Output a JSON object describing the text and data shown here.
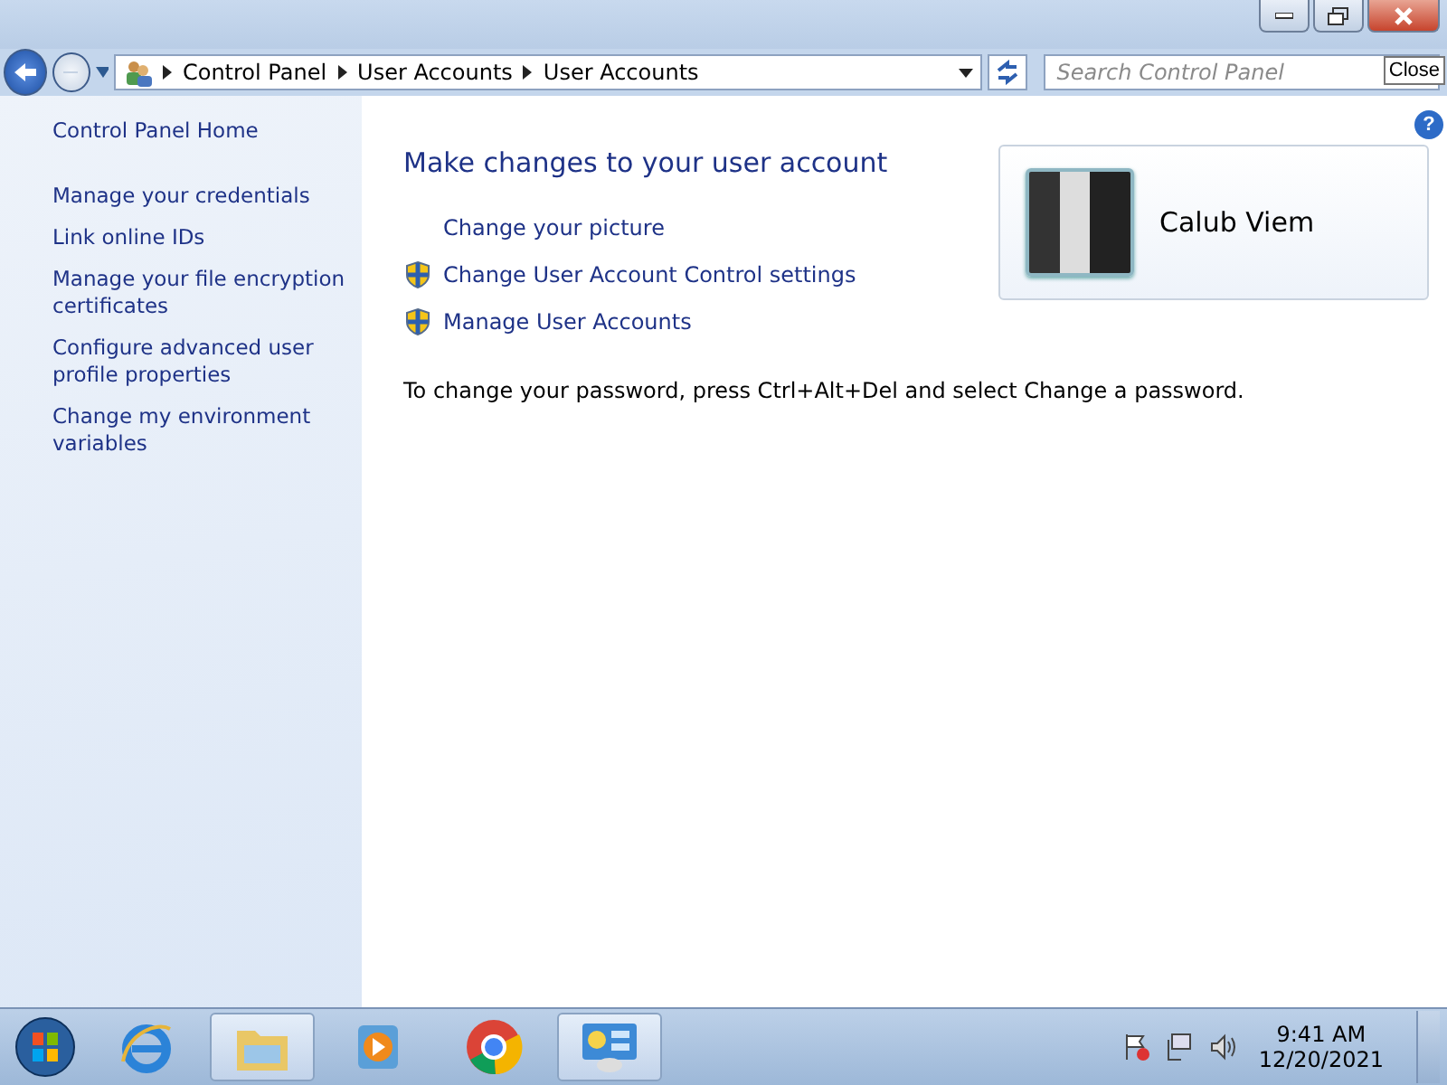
{
  "window": {
    "tooltip": "Close"
  },
  "address_bar": {
    "breadcrumbs": [
      "Control Panel",
      "User Accounts",
      "User Accounts"
    ]
  },
  "search": {
    "placeholder": "Search Control Panel"
  },
  "help_button": "?",
  "sidebar": {
    "items": [
      {
        "label": "Control Panel Home"
      },
      {
        "label": "Manage your credentials"
      },
      {
        "label": "Link online IDs"
      },
      {
        "label": "Manage your file encryption certificates"
      },
      {
        "label": "Configure advanced user profile properties"
      },
      {
        "label": "Change my environment variables"
      }
    ]
  },
  "main": {
    "heading": "Make changes to your user account",
    "tasks": [
      {
        "label": "Change your picture",
        "shield": false
      },
      {
        "label": "Change User Account Control settings",
        "shield": true
      },
      {
        "label": "Manage User Accounts",
        "shield": true
      }
    ],
    "note": "To change your password, press Ctrl+Alt+Del and select Change a password.",
    "account": {
      "name": "Calub Viem"
    }
  },
  "taskbar": {
    "items": [
      {
        "kind": "browser-e",
        "open": false
      },
      {
        "kind": "folder",
        "open": true
      },
      {
        "kind": "media",
        "open": false
      },
      {
        "kind": "chrome",
        "open": false
      },
      {
        "kind": "panel",
        "open": true
      }
    ],
    "time": "9:41 AM",
    "date": "12/20/2021"
  }
}
